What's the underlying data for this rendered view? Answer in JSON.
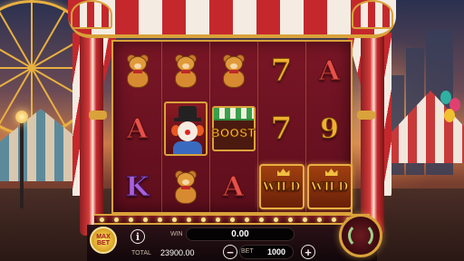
{
  "game": {
    "reels": [
      [
        "bear",
        "A",
        "K"
      ],
      [
        "bear",
        "clown",
        "bear"
      ],
      [
        "bear",
        "boost",
        "A"
      ],
      [
        "7",
        "7",
        "wild"
      ],
      [
        "A",
        "9",
        "wild"
      ]
    ],
    "symbols": {
      "boost_label": "BOOST",
      "wild_label": "WILD"
    }
  },
  "controls": {
    "max_bet_line1": "MAX",
    "max_bet_line2": "BET",
    "info_label": "i",
    "win_label": "WIN",
    "win_value": "0.00",
    "total_label": "TOTAL",
    "total_value": "23900.00",
    "bet_label": "BET",
    "bet_value": "1000",
    "minus_label": "−",
    "plus_label": "+"
  },
  "colors": {
    "curtain_red": "#c5282c",
    "curtain_cream": "#f4ece2",
    "gold_trim": "#d9a23a",
    "reel_bg": "#7a1626"
  }
}
